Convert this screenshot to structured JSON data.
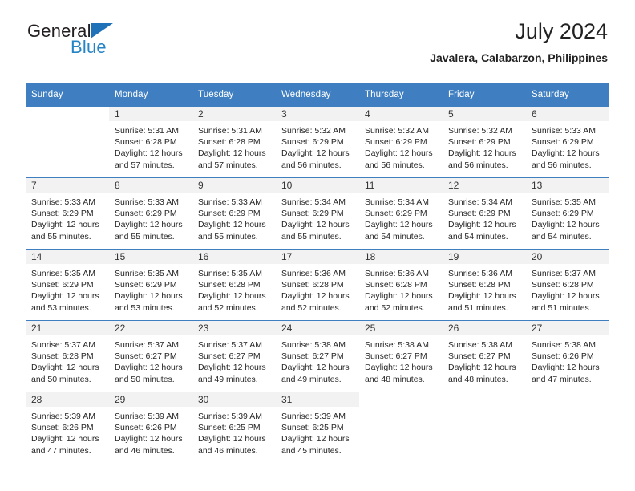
{
  "brand": {
    "name_part1": "General",
    "name_part2": "Blue",
    "triangle_color": "#1f71b8",
    "blue_color": "#2484c6"
  },
  "header": {
    "title": "July 2024",
    "subtitle": "Javalera, Calabarzon, Philippines"
  },
  "theme": {
    "header_bg": "#3f7fc1",
    "header_text": "#ffffff",
    "daynum_bg": "#f2f2f2",
    "grid_line": "#3f7fc1"
  },
  "weekdays": [
    "Sunday",
    "Monday",
    "Tuesday",
    "Wednesday",
    "Thursday",
    "Friday",
    "Saturday"
  ],
  "labels": {
    "sunrise_prefix": "Sunrise:",
    "sunset_prefix": "Sunset:",
    "daylight_prefix": "Daylight:"
  },
  "weeks": [
    [
      {
        "day": "",
        "empty": true,
        "sunrise": "",
        "sunset": "",
        "daylight_line1": "",
        "daylight_line2": ""
      },
      {
        "day": "1",
        "sunrise": "Sunrise: 5:31 AM",
        "sunset": "Sunset: 6:28 PM",
        "daylight_line1": "Daylight: 12 hours",
        "daylight_line2": "and 57 minutes."
      },
      {
        "day": "2",
        "sunrise": "Sunrise: 5:31 AM",
        "sunset": "Sunset: 6:28 PM",
        "daylight_line1": "Daylight: 12 hours",
        "daylight_line2": "and 57 minutes."
      },
      {
        "day": "3",
        "sunrise": "Sunrise: 5:32 AM",
        "sunset": "Sunset: 6:29 PM",
        "daylight_line1": "Daylight: 12 hours",
        "daylight_line2": "and 56 minutes."
      },
      {
        "day": "4",
        "sunrise": "Sunrise: 5:32 AM",
        "sunset": "Sunset: 6:29 PM",
        "daylight_line1": "Daylight: 12 hours",
        "daylight_line2": "and 56 minutes."
      },
      {
        "day": "5",
        "sunrise": "Sunrise: 5:32 AM",
        "sunset": "Sunset: 6:29 PM",
        "daylight_line1": "Daylight: 12 hours",
        "daylight_line2": "and 56 minutes."
      },
      {
        "day": "6",
        "sunrise": "Sunrise: 5:33 AM",
        "sunset": "Sunset: 6:29 PM",
        "daylight_line1": "Daylight: 12 hours",
        "daylight_line2": "and 56 minutes."
      }
    ],
    [
      {
        "day": "7",
        "sunrise": "Sunrise: 5:33 AM",
        "sunset": "Sunset: 6:29 PM",
        "daylight_line1": "Daylight: 12 hours",
        "daylight_line2": "and 55 minutes."
      },
      {
        "day": "8",
        "sunrise": "Sunrise: 5:33 AM",
        "sunset": "Sunset: 6:29 PM",
        "daylight_line1": "Daylight: 12 hours",
        "daylight_line2": "and 55 minutes."
      },
      {
        "day": "9",
        "sunrise": "Sunrise: 5:33 AM",
        "sunset": "Sunset: 6:29 PM",
        "daylight_line1": "Daylight: 12 hours",
        "daylight_line2": "and 55 minutes."
      },
      {
        "day": "10",
        "sunrise": "Sunrise: 5:34 AM",
        "sunset": "Sunset: 6:29 PM",
        "daylight_line1": "Daylight: 12 hours",
        "daylight_line2": "and 55 minutes."
      },
      {
        "day": "11",
        "sunrise": "Sunrise: 5:34 AM",
        "sunset": "Sunset: 6:29 PM",
        "daylight_line1": "Daylight: 12 hours",
        "daylight_line2": "and 54 minutes."
      },
      {
        "day": "12",
        "sunrise": "Sunrise: 5:34 AM",
        "sunset": "Sunset: 6:29 PM",
        "daylight_line1": "Daylight: 12 hours",
        "daylight_line2": "and 54 minutes."
      },
      {
        "day": "13",
        "sunrise": "Sunrise: 5:35 AM",
        "sunset": "Sunset: 6:29 PM",
        "daylight_line1": "Daylight: 12 hours",
        "daylight_line2": "and 54 minutes."
      }
    ],
    [
      {
        "day": "14",
        "sunrise": "Sunrise: 5:35 AM",
        "sunset": "Sunset: 6:29 PM",
        "daylight_line1": "Daylight: 12 hours",
        "daylight_line2": "and 53 minutes."
      },
      {
        "day": "15",
        "sunrise": "Sunrise: 5:35 AM",
        "sunset": "Sunset: 6:29 PM",
        "daylight_line1": "Daylight: 12 hours",
        "daylight_line2": "and 53 minutes."
      },
      {
        "day": "16",
        "sunrise": "Sunrise: 5:35 AM",
        "sunset": "Sunset: 6:28 PM",
        "daylight_line1": "Daylight: 12 hours",
        "daylight_line2": "and 52 minutes."
      },
      {
        "day": "17",
        "sunrise": "Sunrise: 5:36 AM",
        "sunset": "Sunset: 6:28 PM",
        "daylight_line1": "Daylight: 12 hours",
        "daylight_line2": "and 52 minutes."
      },
      {
        "day": "18",
        "sunrise": "Sunrise: 5:36 AM",
        "sunset": "Sunset: 6:28 PM",
        "daylight_line1": "Daylight: 12 hours",
        "daylight_line2": "and 52 minutes."
      },
      {
        "day": "19",
        "sunrise": "Sunrise: 5:36 AM",
        "sunset": "Sunset: 6:28 PM",
        "daylight_line1": "Daylight: 12 hours",
        "daylight_line2": "and 51 minutes."
      },
      {
        "day": "20",
        "sunrise": "Sunrise: 5:37 AM",
        "sunset": "Sunset: 6:28 PM",
        "daylight_line1": "Daylight: 12 hours",
        "daylight_line2": "and 51 minutes."
      }
    ],
    [
      {
        "day": "21",
        "sunrise": "Sunrise: 5:37 AM",
        "sunset": "Sunset: 6:28 PM",
        "daylight_line1": "Daylight: 12 hours",
        "daylight_line2": "and 50 minutes."
      },
      {
        "day": "22",
        "sunrise": "Sunrise: 5:37 AM",
        "sunset": "Sunset: 6:27 PM",
        "daylight_line1": "Daylight: 12 hours",
        "daylight_line2": "and 50 minutes."
      },
      {
        "day": "23",
        "sunrise": "Sunrise: 5:37 AM",
        "sunset": "Sunset: 6:27 PM",
        "daylight_line1": "Daylight: 12 hours",
        "daylight_line2": "and 49 minutes."
      },
      {
        "day": "24",
        "sunrise": "Sunrise: 5:38 AM",
        "sunset": "Sunset: 6:27 PM",
        "daylight_line1": "Daylight: 12 hours",
        "daylight_line2": "and 49 minutes."
      },
      {
        "day": "25",
        "sunrise": "Sunrise: 5:38 AM",
        "sunset": "Sunset: 6:27 PM",
        "daylight_line1": "Daylight: 12 hours",
        "daylight_line2": "and 48 minutes."
      },
      {
        "day": "26",
        "sunrise": "Sunrise: 5:38 AM",
        "sunset": "Sunset: 6:27 PM",
        "daylight_line1": "Daylight: 12 hours",
        "daylight_line2": "and 48 minutes."
      },
      {
        "day": "27",
        "sunrise": "Sunrise: 5:38 AM",
        "sunset": "Sunset: 6:26 PM",
        "daylight_line1": "Daylight: 12 hours",
        "daylight_line2": "and 47 minutes."
      }
    ],
    [
      {
        "day": "28",
        "sunrise": "Sunrise: 5:39 AM",
        "sunset": "Sunset: 6:26 PM",
        "daylight_line1": "Daylight: 12 hours",
        "daylight_line2": "and 47 minutes."
      },
      {
        "day": "29",
        "sunrise": "Sunrise: 5:39 AM",
        "sunset": "Sunset: 6:26 PM",
        "daylight_line1": "Daylight: 12 hours",
        "daylight_line2": "and 46 minutes."
      },
      {
        "day": "30",
        "sunrise": "Sunrise: 5:39 AM",
        "sunset": "Sunset: 6:25 PM",
        "daylight_line1": "Daylight: 12 hours",
        "daylight_line2": "and 46 minutes."
      },
      {
        "day": "31",
        "sunrise": "Sunrise: 5:39 AM",
        "sunset": "Sunset: 6:25 PM",
        "daylight_line1": "Daylight: 12 hours",
        "daylight_line2": "and 45 minutes."
      },
      {
        "day": "",
        "empty": true,
        "sunrise": "",
        "sunset": "",
        "daylight_line1": "",
        "daylight_line2": ""
      },
      {
        "day": "",
        "empty": true,
        "sunrise": "",
        "sunset": "",
        "daylight_line1": "",
        "daylight_line2": ""
      },
      {
        "day": "",
        "empty": true,
        "sunrise": "",
        "sunset": "",
        "daylight_line1": "",
        "daylight_line2": ""
      }
    ]
  ]
}
